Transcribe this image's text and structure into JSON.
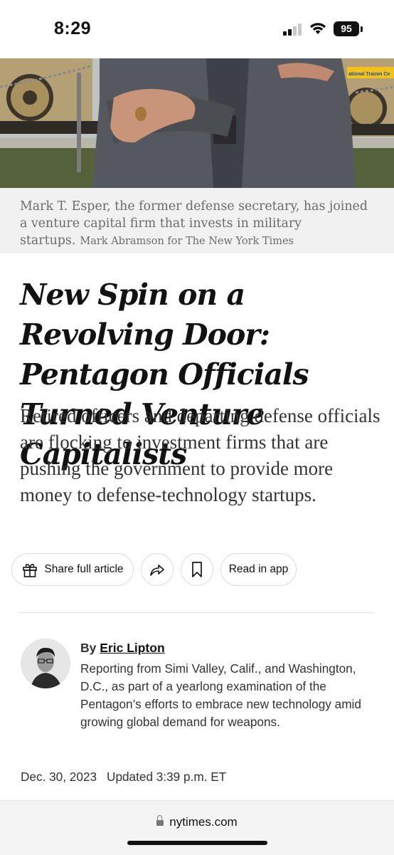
{
  "status_bar": {
    "time": "8:29",
    "battery": "95"
  },
  "photo": {
    "sign_text": "ational Trainin Ce",
    "caption": "Mark T. Esper, the former defense secretary, has joined a venture capital firm that invests in military startups.",
    "credit": "Mark Abramson for The New York Times"
  },
  "article": {
    "headline": "New Spin on a Revolving Door: Pentagon Officials Turned Venture Capitalists",
    "summary": "Retired officers and departing defense officials are flocking to investment firms that are pushing the government to provide more money to defense-technology startups."
  },
  "actions": {
    "share_full_label": "Share full article",
    "read_in_app_label": "Read in app"
  },
  "byline": {
    "prefix": "By",
    "author": "Eric Lipton",
    "reporting": "Reporting from Simi Valley, Calif., and Washington, D.C., as part of a yearlong examination of the Pentagon’s efforts to embrace new technology amid growing global demand for weapons."
  },
  "dates": {
    "published": "Dec. 30, 2023",
    "updated": "Updated 3:39 p.m. ET"
  },
  "browser": {
    "url": "nytimes.com"
  }
}
